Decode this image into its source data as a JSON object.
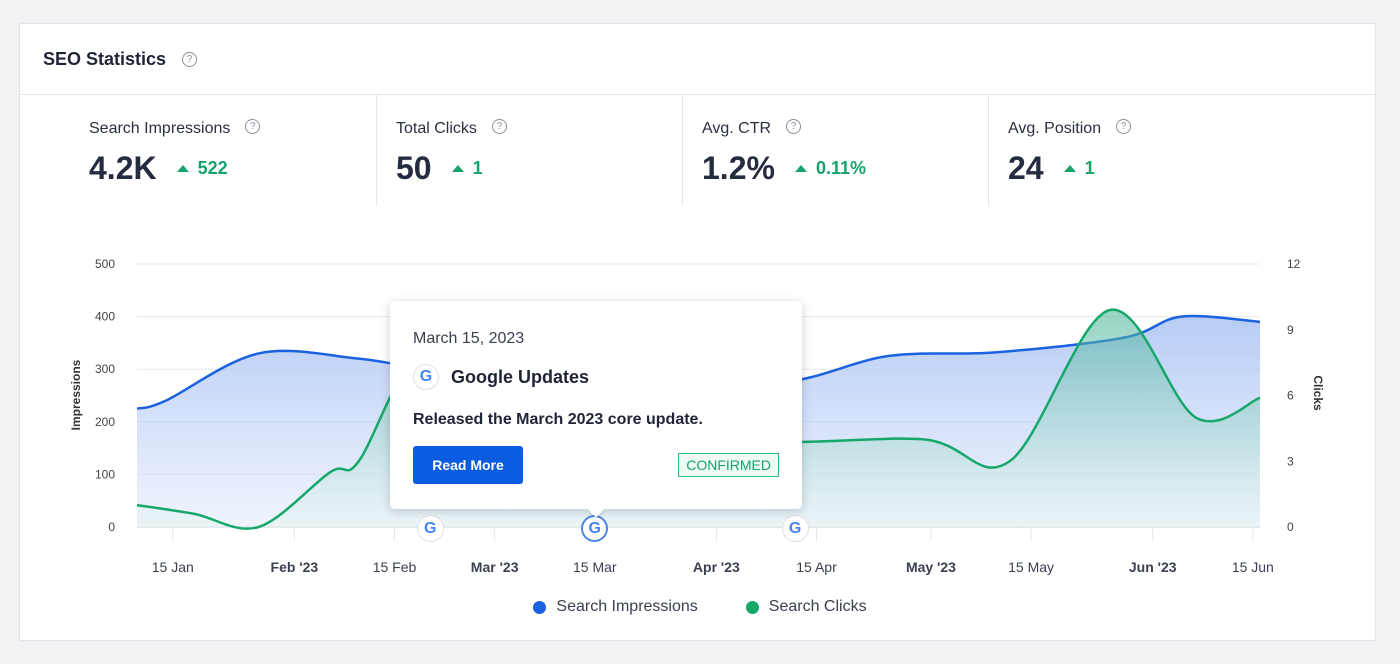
{
  "header": {
    "title": "SEO Statistics",
    "help_icon": "question-circle-icon"
  },
  "stats": [
    {
      "label": "Search Impressions",
      "value": "4.2K",
      "delta": "522"
    },
    {
      "label": "Total Clicks",
      "value": "50",
      "delta": "1"
    },
    {
      "label": "Avg. CTR",
      "value": "1.2%",
      "delta": "0.11%"
    },
    {
      "label": "Avg. Position",
      "value": "24",
      "delta": "1"
    }
  ],
  "tooltip": {
    "date": "March 15, 2023",
    "title": "Google Updates",
    "description": "Released the March 2023 core update.",
    "button": "Read More",
    "badge": "CONFIRMED"
  },
  "colors": {
    "impressions": "#1a62e0",
    "clicks": "#16a86a",
    "accent": "#0b5ce0",
    "positive": "#16a36b"
  },
  "chart_data": {
    "type": "area",
    "ylabel": "Impressions",
    "y2label": "Clicks",
    "ylim": [
      0,
      500
    ],
    "y2lim": [
      0,
      12
    ],
    "yticks": [
      "0",
      "100",
      "200",
      "300",
      "400",
      "500"
    ],
    "y2ticks": [
      "0",
      "3",
      "6",
      "9",
      "12"
    ],
    "xticks": [
      {
        "date": "2023-01-15",
        "label": "15 Jan",
        "bold": false
      },
      {
        "date": "2023-02-01",
        "label": "Feb '23",
        "bold": true
      },
      {
        "date": "2023-02-15",
        "label": "15 Feb",
        "bold": false
      },
      {
        "date": "2023-03-01",
        "label": "Mar '23",
        "bold": true
      },
      {
        "date": "2023-03-15",
        "label": "15 Mar",
        "bold": false
      },
      {
        "date": "2023-04-01",
        "label": "Apr '23",
        "bold": true
      },
      {
        "date": "2023-04-15",
        "label": "15 Apr",
        "bold": false
      },
      {
        "date": "2023-05-01",
        "label": "May '23",
        "bold": true
      },
      {
        "date": "2023-05-15",
        "label": "15 May",
        "bold": false
      },
      {
        "date": "2023-06-01",
        "label": "Jun '23",
        "bold": true
      },
      {
        "date": "2023-06-15",
        "label": "15 Jun",
        "bold": false
      }
    ],
    "xlim": [
      "2023-01-10",
      "2023-06-16"
    ],
    "grid": true,
    "legend": "bottom",
    "series": [
      {
        "name": "Search Impressions",
        "axis": "left",
        "points": [
          [
            "2023-01-10",
            225
          ],
          [
            "2023-01-14",
            240
          ],
          [
            "2023-01-27",
            330
          ],
          [
            "2023-02-10",
            320
          ],
          [
            "2023-02-20",
            300
          ],
          [
            "2023-03-05",
            295
          ],
          [
            "2023-03-22",
            288
          ],
          [
            "2023-04-10",
            275
          ],
          [
            "2023-04-25",
            325
          ],
          [
            "2023-05-10",
            332
          ],
          [
            "2023-05-28",
            360
          ],
          [
            "2023-06-05",
            400
          ],
          [
            "2023-06-16",
            390
          ]
        ]
      },
      {
        "name": "Search Clicks",
        "axis": "right",
        "points": [
          [
            "2023-01-10",
            1
          ],
          [
            "2023-01-18",
            0.6
          ],
          [
            "2023-01-27",
            0
          ],
          [
            "2023-02-06",
            2.5
          ],
          [
            "2023-02-10",
            3
          ],
          [
            "2023-02-18",
            7.8
          ],
          [
            "2023-03-01",
            9
          ],
          [
            "2023-03-20",
            6
          ],
          [
            "2023-04-06",
            4
          ],
          [
            "2023-04-30",
            4
          ],
          [
            "2023-05-12",
            3
          ],
          [
            "2023-05-26",
            9.9
          ],
          [
            "2023-06-07",
            5
          ],
          [
            "2023-06-16",
            5.9
          ]
        ]
      }
    ],
    "events": [
      {
        "date": "2023-02-20",
        "icon": "google-icon"
      },
      {
        "date": "2023-03-15",
        "icon": "google-icon",
        "active": true
      },
      {
        "date": "2023-04-12",
        "icon": "google-icon"
      }
    ]
  },
  "legend": [
    "Search Impressions",
    "Search Clicks"
  ]
}
